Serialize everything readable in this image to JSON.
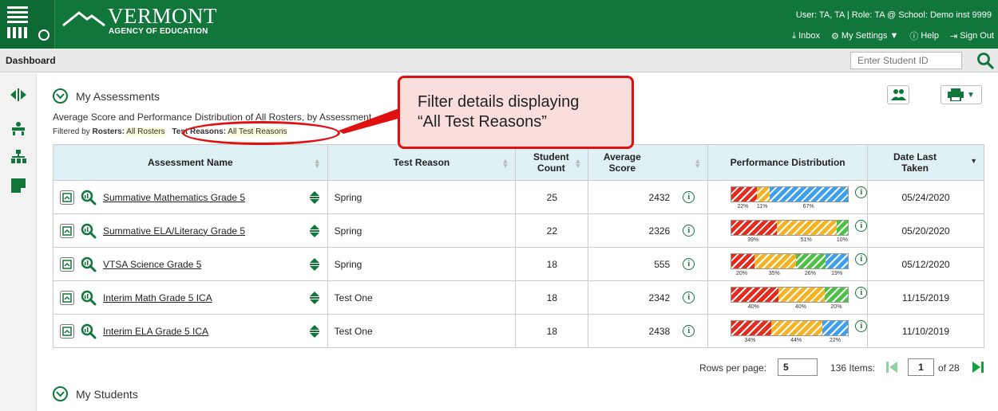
{
  "header": {
    "agency_name": "VERMONT",
    "agency_sub": "AGENCY OF EDUCATION",
    "user_line": "User: TA, TA  |  Role: TA @ School: Demo inst 9999",
    "inbox": "Inbox",
    "settings": "My Settings ▼",
    "help": "Help",
    "signout": "Sign Out"
  },
  "dashbar": {
    "title": "Dashboard",
    "student_id_placeholder": "Enter Student ID"
  },
  "section": {
    "title": "My Assessments",
    "subtitle": "Average Score and Performance Distribution of All Rosters, by Assessment",
    "filter_prefix": "Filtered by",
    "rosters_label": "Rosters:",
    "rosters_value": "All Rosters",
    "reasons_label": "Test Reasons:",
    "reasons_value": "All Test Reasons"
  },
  "callout": {
    "line1": "Filter details displaying",
    "line2": "“All Test Reasons”"
  },
  "table": {
    "headers": [
      "Assessment Name",
      "Test Reason",
      "Student Count",
      "Average Score",
      "Performance Distribution",
      "Date Last Taken"
    ],
    "rows": [
      {
        "name": "Summative Mathematics Grade 5",
        "reason": "Spring",
        "count": "25",
        "score": "2432",
        "dist": [
          22,
          11,
          67
        ],
        "colors": [
          "r",
          "o",
          "b"
        ],
        "labels": [
          "22%",
          "11%",
          "67%"
        ],
        "date": "05/24/2020"
      },
      {
        "name": "Summative ELA/Literacy Grade 5",
        "reason": "Spring",
        "count": "22",
        "score": "2326",
        "dist": [
          39,
          51,
          10
        ],
        "colors": [
          "r",
          "o",
          "g"
        ],
        "labels": [
          "39%",
          "51%",
          "10%"
        ],
        "date": "05/20/2020"
      },
      {
        "name": "VTSA Science Grade 5",
        "reason": "Spring",
        "count": "18",
        "score": "555",
        "dist": [
          20,
          35,
          26,
          19
        ],
        "colors": [
          "r",
          "o",
          "g",
          "b"
        ],
        "labels": [
          "20%",
          "35%",
          "26%",
          "19%"
        ],
        "date": "05/12/2020"
      },
      {
        "name": "Interim Math Grade 5 ICA",
        "reason": "Test One",
        "count": "18",
        "score": "2342",
        "dist": [
          40,
          40,
          20
        ],
        "colors": [
          "r",
          "o",
          "g"
        ],
        "labels": [
          "40%",
          "40%",
          "20%"
        ],
        "date": "11/15/2019"
      },
      {
        "name": "Interim ELA Grade 5 ICA",
        "reason": "Test One",
        "count": "18",
        "score": "2438",
        "dist": [
          34,
          44,
          22
        ],
        "colors": [
          "r",
          "o",
          "b"
        ],
        "labels": [
          "34%",
          "44%",
          "22%"
        ],
        "date": "11/10/2019"
      }
    ]
  },
  "pagination": {
    "rows_label": "Rows per page:",
    "rows_value": "5",
    "items": "136 Items:",
    "page": "1",
    "of": "of 28"
  },
  "section2": {
    "title": "My Students"
  },
  "colors": {
    "r": "#e52b1d",
    "o": "#f5b324",
    "g": "#4cc244",
    "b": "#3d9ff0",
    "brand": "#10763a"
  }
}
